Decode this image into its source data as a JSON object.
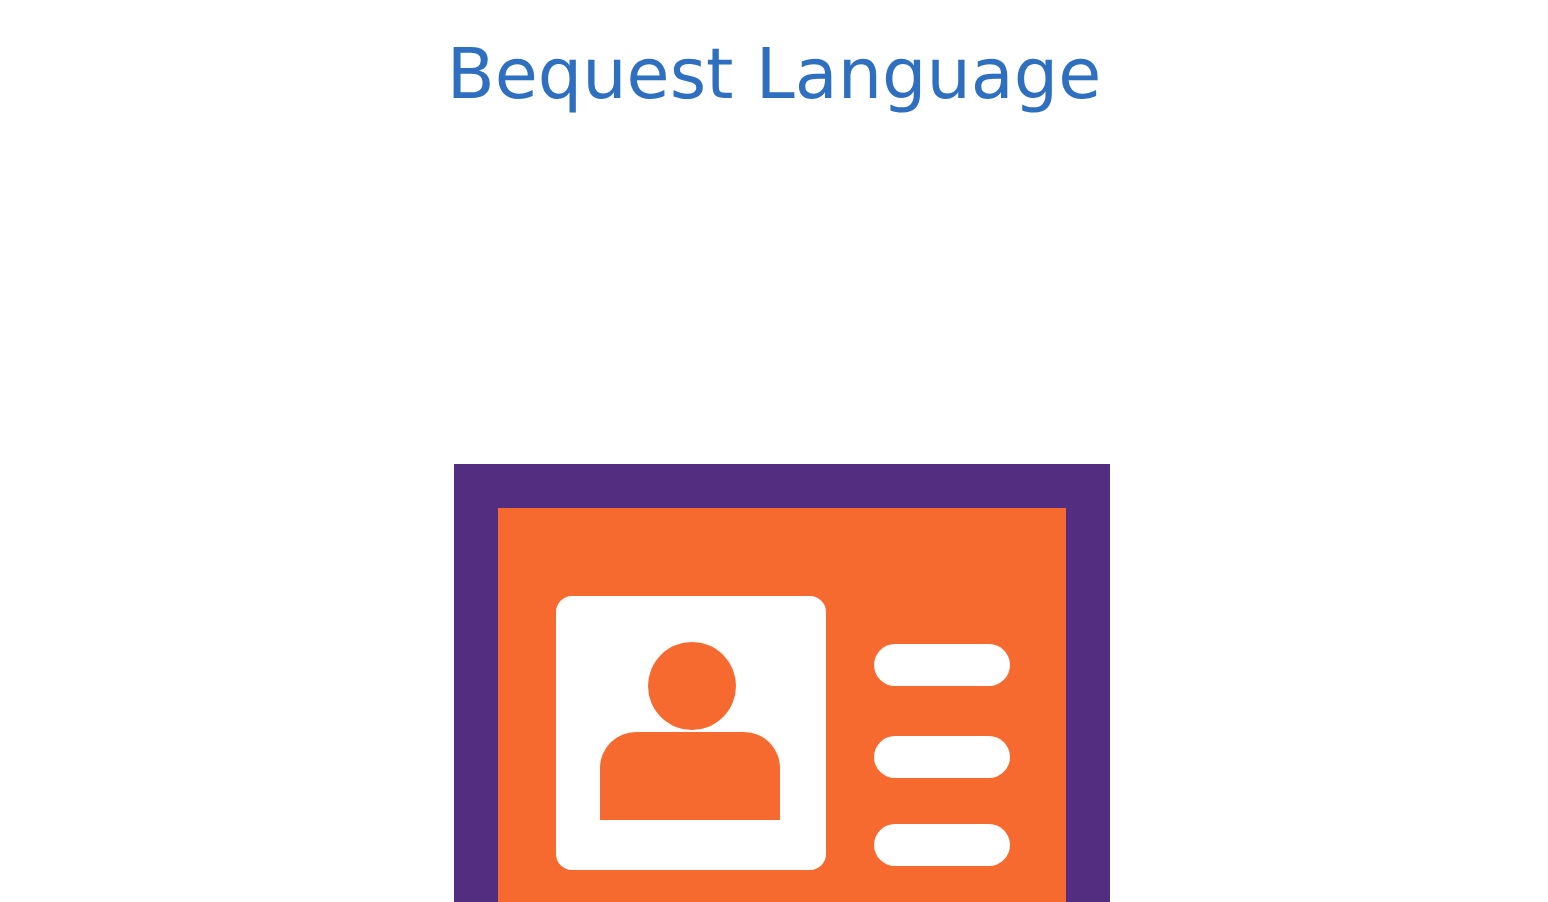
{
  "heading": {
    "title": "Bequest Language"
  }
}
